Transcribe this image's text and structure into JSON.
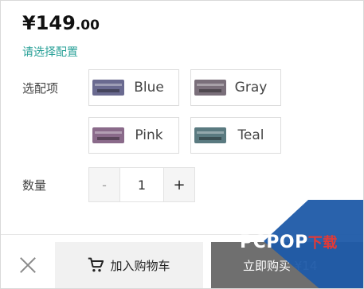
{
  "price": {
    "main": "¥149",
    "decimal": ".00"
  },
  "select_hint": "请选择配置",
  "options_label": "选配项",
  "options": [
    {
      "label": "Blue",
      "thumb_color": "#6a6a90"
    },
    {
      "label": "Gray",
      "thumb_color": "#7a6f7a"
    },
    {
      "label": "Pink",
      "thumb_color": "#8a6a8a"
    },
    {
      "label": "Teal",
      "thumb_color": "#5a7a80"
    }
  ],
  "quantity": {
    "label": "数量",
    "minus": "-",
    "value": "1",
    "plus": "+"
  },
  "footer": {
    "cart_label": "加入购物车",
    "buy_label": "立即购买 ¥14"
  },
  "watermark": {
    "text": "PCPOP",
    "text_cn": "下载",
    "accent": "#1e5aa8"
  }
}
